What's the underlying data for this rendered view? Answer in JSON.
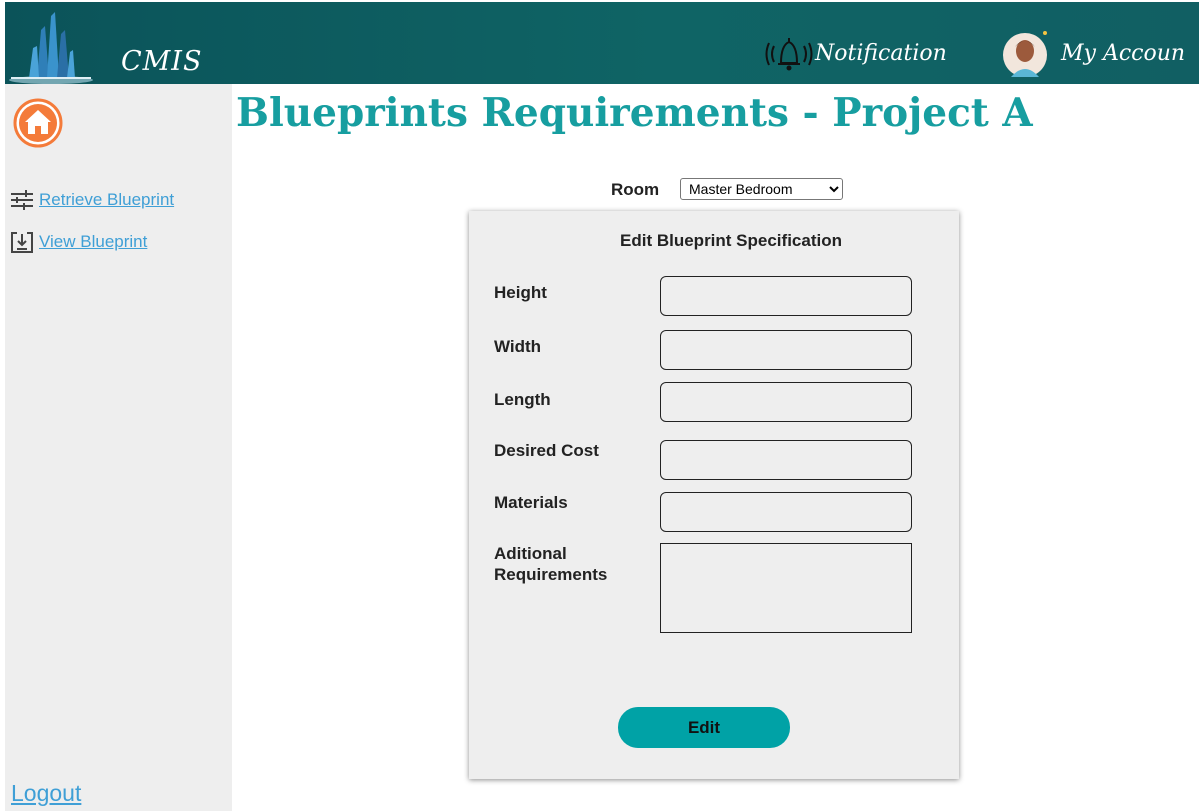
{
  "header": {
    "brand": "CMIS",
    "notification_label": "Notification",
    "account_label": "My Accoun"
  },
  "sidebar": {
    "items": [
      {
        "label": "Retrieve Blueprint",
        "icon": "sliders-icon"
      },
      {
        "label": "View Blueprint",
        "icon": "download-box-icon"
      }
    ],
    "logout_label": "Logout"
  },
  "main": {
    "title": "Blueprints Requirements - Project A",
    "room_label": "Room",
    "room_selected": "Master Bedroom",
    "form": {
      "title": "Edit Blueprint Specification",
      "fields": [
        {
          "label": "Height",
          "value": ""
        },
        {
          "label": "Width",
          "value": ""
        },
        {
          "label": "Length",
          "value": ""
        },
        {
          "label": "Desired Cost",
          "value": ""
        },
        {
          "label": "Materials",
          "value": ""
        }
      ],
      "additional_label_line1": "Aditional",
      "additional_label_line2": "Requirements",
      "submit_label": "Edit"
    }
  },
  "colors": {
    "header_bg": "#0f6465",
    "accent": "#179ea0",
    "button": "#00a2a6",
    "link": "#3f9fd6",
    "home_icon": "#f47b3a"
  }
}
